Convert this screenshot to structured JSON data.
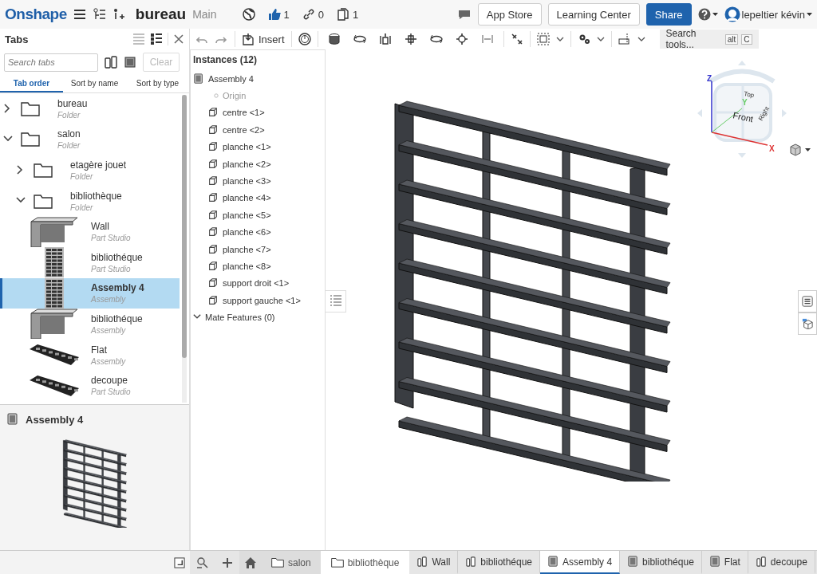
{
  "header": {
    "logo": "Onshape",
    "document_title": "bureau",
    "branch": "Main",
    "likes": "1",
    "links": "0",
    "copies": "1",
    "buttons": [
      {
        "label": "App Store",
        "kind": "plain"
      },
      {
        "label": "Learning Center",
        "kind": "plain"
      },
      {
        "label": "Share",
        "kind": "primary"
      }
    ],
    "user": "lepeltier kévin"
  },
  "tabs_panel": {
    "title": "Tabs",
    "search": {
      "placeholder": "Search tabs"
    },
    "clear": "Clear",
    "sort": [
      {
        "label": "Tab order",
        "selected": true
      },
      {
        "label": "Sort by name",
        "selected": false
      },
      {
        "label": "Sort by type",
        "selected": false
      }
    ],
    "tree": [
      {
        "name": "bureau",
        "type": "Folder",
        "kind": "folder",
        "expanded": false,
        "selected": false
      },
      {
        "name": "salon",
        "type": "Folder",
        "kind": "folder",
        "expanded": true,
        "selected": false,
        "children": [
          {
            "name": "etagère jouet",
            "type": "Folder",
            "kind": "folder",
            "expanded": false,
            "selected": false
          },
          {
            "name": "bibliothèque",
            "type": "Folder",
            "kind": "folder",
            "expanded": true,
            "selected": false,
            "children": [
              {
                "name": "Wall",
                "type": "Part Studio",
                "kind": "wall",
                "selected": false
              },
              {
                "name": "bibliothéque",
                "type": "Part Studio",
                "kind": "shelf",
                "selected": false
              },
              {
                "name": "Assembly 4",
                "type": "Assembly",
                "kind": "shelf",
                "selected": true
              },
              {
                "name": "bibliothéque",
                "type": "Assembly",
                "kind": "wall",
                "selected": false
              },
              {
                "name": "Flat",
                "type": "Assembly",
                "kind": "flat",
                "selected": false
              },
              {
                "name": "decoupe",
                "type": "Part Studio",
                "kind": "flat",
                "selected": false
              }
            ]
          }
        ]
      }
    ]
  },
  "preview": {
    "title": "Assembly 4"
  },
  "toolbar": {
    "insert": "Insert",
    "search": "Search tools...",
    "keys": [
      "alt",
      "C"
    ]
  },
  "instances": {
    "title": "Instances (12)",
    "root": "Assembly 4",
    "origin": "Origin",
    "items": [
      "centre <1>",
      "centre <2>",
      "planche <1>",
      "planche <2>",
      "planche <3>",
      "planche <4>",
      "planche <5>",
      "planche <6>",
      "planche <7>",
      "planche <8>",
      "support droit <1>",
      "support gauche <1>"
    ],
    "mate_features": {
      "label": "Mate Features (0)",
      "expanded": true
    }
  },
  "view_cube": {
    "faces": [
      "Top",
      "Front",
      "Right"
    ],
    "axes": [
      "Z",
      "Y",
      "X"
    ]
  },
  "bottom_bar": {
    "breadcrumbs": [
      "salon",
      "bibliothèque"
    ],
    "tabs": [
      {
        "label": "Wall",
        "kind": "part_studio",
        "selected": false
      },
      {
        "label": "bibliothéque",
        "kind": "part_studio",
        "selected": false
      },
      {
        "label": "Assembly 4",
        "kind": "assembly",
        "selected": true
      },
      {
        "label": "bibliothéque",
        "kind": "assembly",
        "selected": false
      },
      {
        "label": "Flat",
        "kind": "assembly",
        "selected": false
      },
      {
        "label": "decoupe",
        "kind": "part_studio",
        "selected": false
      }
    ]
  }
}
